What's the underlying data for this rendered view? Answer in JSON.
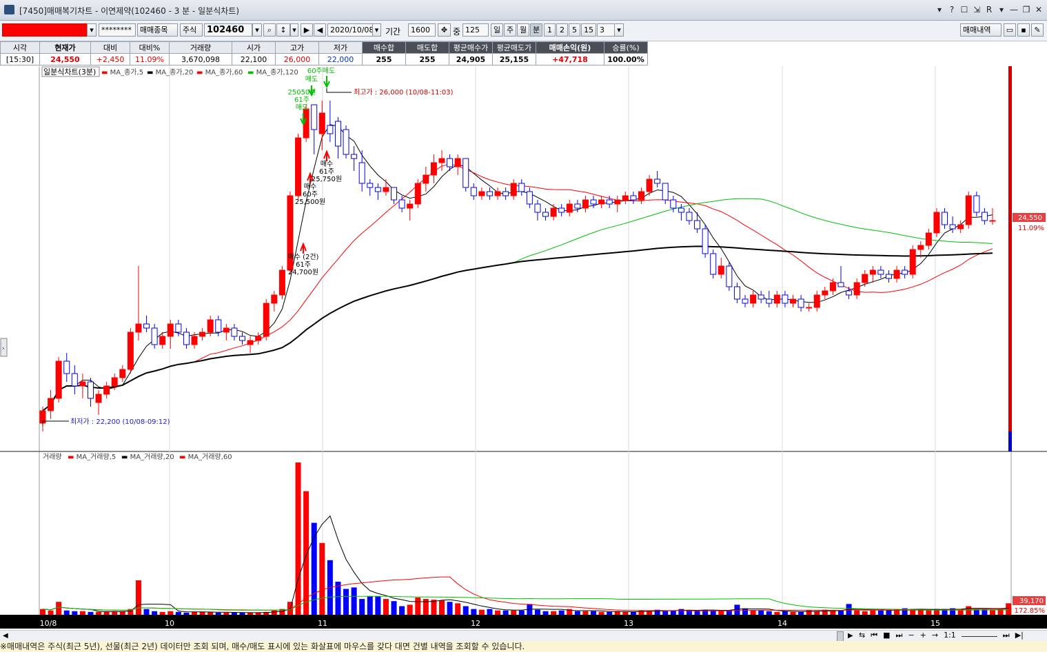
{
  "window": {
    "title": "[7450]매매복기차트 - 이연제약(102460 - 3 분 - 일분식차트)",
    "controls": [
      "▾",
      "?",
      "☐",
      "⇲",
      "R",
      "▾",
      "—",
      "❐",
      "✕"
    ]
  },
  "toolbar": {
    "password": "********",
    "btn_stock": "매매종목",
    "market": "주식",
    "code": "102460",
    "date": "2020/10/08",
    "period_label": "기간",
    "period_value": "1600",
    "count_label": "중",
    "count_value": "125",
    "units": [
      "일",
      "주",
      "월",
      "분",
      "1",
      "2",
      "5",
      "15",
      "3"
    ],
    "btn_trades": "매매내역"
  },
  "quote": {
    "headers": [
      "시각",
      "현재가",
      "대비",
      "대비%",
      "거래량",
      "시가",
      "고가",
      "저가",
      "매수합",
      "매도합",
      "평균매수가",
      "평균매도가",
      "매매손익(원)",
      "승률(%)"
    ],
    "values": [
      "[15:30]",
      "24,550",
      "+2,450",
      "11.09%",
      "3,670,098",
      "22,100",
      "26,000",
      "22,000",
      "255",
      "255",
      "24,905",
      "25,155",
      "+47,718",
      "100.00%"
    ]
  },
  "legend_price": {
    "title": "일분식차트(3분)",
    "items": [
      "MA_종가,5",
      "MA_종가,20",
      "MA_종가,60",
      "MA_종가,120"
    ]
  },
  "legend_volume": {
    "title": "거래량",
    "items": [
      "MA_거래량,5",
      "MA_거래량,20",
      "MA_거래량,60"
    ]
  },
  "annotations": {
    "high": "최고가 : 26,000 (10/08-11:03)",
    "low": "최저가 : 22,200 (10/08-09:12)",
    "buy1": [
      "매수 (2건)",
      "61주",
      "24,700원"
    ],
    "buy2": [
      "매수",
      "60주",
      "25,500원"
    ],
    "buy3": [
      "매수",
      "61주",
      "25,750원"
    ],
    "sell1": [
      "25050원",
      "61주",
      "매도"
    ],
    "sell2": [
      "60주매도",
      "매도"
    ]
  },
  "right_axis": {
    "price": "24,550",
    "pct": "11.09%",
    "vol": "39,170",
    "vol_pct": "172.85%"
  },
  "x_labels": [
    "10/8",
    "10",
    "11",
    "12",
    "13",
    "14",
    "15"
  ],
  "colors": {
    "up": "#ff0000",
    "down": "#0000ff",
    "ma5": "#000000",
    "ma20": "#ff0000",
    "ma60": "#00c000",
    "ma120": "#000000"
  },
  "status": "※매매내역은 주식(최근 5년), 선물(최근 2년) 데이터만 조회 되며, 매수/매도 표시에 있는 화살표에 마우스를 갖다 대면 건별 내역을 조회할 수 있습니다.",
  "zoom": "1:1",
  "chart_data": {
    "type": "candlestick",
    "interval": "3분",
    "series": [
      {
        "o": 22100,
        "h": 22300,
        "l": 22000,
        "c": 22250
      },
      {
        "o": 22250,
        "h": 22500,
        "l": 22150,
        "c": 22400
      },
      {
        "o": 22400,
        "h": 22900,
        "l": 22350,
        "c": 22850
      },
      {
        "o": 22850,
        "h": 22950,
        "l": 22600,
        "c": 22700
      },
      {
        "o": 22700,
        "h": 22800,
        "l": 22450,
        "c": 22550
      },
      {
        "o": 22550,
        "h": 22700,
        "l": 22400,
        "c": 22600
      },
      {
        "o": 22600,
        "h": 22650,
        "l": 22300,
        "c": 22400
      },
      {
        "o": 22350,
        "h": 22500,
        "l": 22200,
        "c": 22450
      },
      {
        "o": 22450,
        "h": 22600,
        "l": 22400,
        "c": 22550
      },
      {
        "o": 22550,
        "h": 22700,
        "l": 22500,
        "c": 22650
      },
      {
        "o": 22650,
        "h": 22800,
        "l": 22600,
        "c": 22750
      },
      {
        "o": 22750,
        "h": 23250,
        "l": 22700,
        "c": 23200
      },
      {
        "o": 23200,
        "h": 24000,
        "l": 23100,
        "c": 23300
      },
      {
        "o": 23300,
        "h": 23400,
        "l": 23200,
        "c": 23250
      },
      {
        "o": 23250,
        "h": 23300,
        "l": 23000,
        "c": 23050
      },
      {
        "o": 23050,
        "h": 23200,
        "l": 23000,
        "c": 23150
      },
      {
        "o": 23150,
        "h": 23350,
        "l": 23000,
        "c": 23300
      },
      {
        "o": 23300,
        "h": 23350,
        "l": 23150,
        "c": 23200
      },
      {
        "o": 23200,
        "h": 23250,
        "l": 23000,
        "c": 23050
      },
      {
        "o": 23050,
        "h": 23200,
        "l": 23000,
        "c": 23150
      },
      {
        "o": 23150,
        "h": 23250,
        "l": 23100,
        "c": 23200
      },
      {
        "o": 23200,
        "h": 23400,
        "l": 23150,
        "c": 23350
      },
      {
        "o": 23350,
        "h": 23400,
        "l": 23150,
        "c": 23200
      },
      {
        "o": 23200,
        "h": 23300,
        "l": 23100,
        "c": 23250
      },
      {
        "o": 23250,
        "h": 23300,
        "l": 23100,
        "c": 23150
      },
      {
        "o": 23150,
        "h": 23200,
        "l": 23050,
        "c": 23100
      },
      {
        "o": 23050,
        "h": 23150,
        "l": 22950,
        "c": 23100
      },
      {
        "o": 23100,
        "h": 23200,
        "l": 23050,
        "c": 23150
      },
      {
        "o": 23150,
        "h": 23600,
        "l": 23100,
        "c": 23550
      },
      {
        "o": 23550,
        "h": 23700,
        "l": 23450,
        "c": 23650
      },
      {
        "o": 23650,
        "h": 24000,
        "l": 23600,
        "c": 23950
      },
      {
        "o": 23950,
        "h": 24900,
        "l": 23900,
        "c": 24850
      },
      {
        "o": 24850,
        "h": 25600,
        "l": 24800,
        "c": 25550
      },
      {
        "o": 25550,
        "h": 25950,
        "l": 25500,
        "c": 25900
      },
      {
        "o": 25950,
        "h": 25950,
        "l": 25350,
        "c": 25650
      },
      {
        "o": 25600,
        "h": 26000,
        "l": 25400,
        "c": 25850
      },
      {
        "o": 25700,
        "h": 26000,
        "l": 25500,
        "c": 25600
      },
      {
        "o": 25750,
        "h": 25800,
        "l": 25300,
        "c": 25450
      },
      {
        "o": 25650,
        "h": 25700,
        "l": 25300,
        "c": 25350
      },
      {
        "o": 25350,
        "h": 25450,
        "l": 25150,
        "c": 25300
      },
      {
        "o": 25250,
        "h": 25400,
        "l": 24900,
        "c": 25000
      },
      {
        "o": 25000,
        "h": 25050,
        "l": 24850,
        "c": 24950
      },
      {
        "o": 24950,
        "h": 25000,
        "l": 24800,
        "c": 24900
      },
      {
        "o": 24900,
        "h": 25050,
        "l": 24850,
        "c": 24950
      },
      {
        "o": 24950,
        "h": 24950,
        "l": 24750,
        "c": 24800
      },
      {
        "o": 24800,
        "h": 24850,
        "l": 24650,
        "c": 24700
      },
      {
        "o": 24700,
        "h": 24800,
        "l": 24550,
        "c": 24750
      },
      {
        "o": 24750,
        "h": 25050,
        "l": 24700,
        "c": 25000
      },
      {
        "o": 25000,
        "h": 25200,
        "l": 24900,
        "c": 25100
      },
      {
        "o": 25100,
        "h": 25350,
        "l": 25000,
        "c": 25250
      },
      {
        "o": 25250,
        "h": 25400,
        "l": 25150,
        "c": 25300
      },
      {
        "o": 25300,
        "h": 25350,
        "l": 25150,
        "c": 25200
      },
      {
        "o": 25200,
        "h": 25350,
        "l": 25100,
        "c": 25300
      },
      {
        "o": 25300,
        "h": 25300,
        "l": 24900,
        "c": 24950
      },
      {
        "o": 24950,
        "h": 25000,
        "l": 24800,
        "c": 24850
      },
      {
        "o": 24850,
        "h": 24950,
        "l": 24800,
        "c": 24900
      },
      {
        "o": 24900,
        "h": 24950,
        "l": 24800,
        "c": 24850
      },
      {
        "o": 24850,
        "h": 24950,
        "l": 24800,
        "c": 24900
      },
      {
        "o": 24900,
        "h": 24950,
        "l": 24800,
        "c": 24850
      },
      {
        "o": 24850,
        "h": 25050,
        "l": 24800,
        "c": 25000
      },
      {
        "o": 25000,
        "h": 25050,
        "l": 24850,
        "c": 24900
      },
      {
        "o": 24900,
        "h": 24950,
        "l": 24700,
        "c": 24750
      },
      {
        "o": 24750,
        "h": 24800,
        "l": 24550,
        "c": 24650
      },
      {
        "o": 24650,
        "h": 24700,
        "l": 24550,
        "c": 24600
      },
      {
        "o": 24600,
        "h": 24750,
        "l": 24550,
        "c": 24700
      },
      {
        "o": 24700,
        "h": 24750,
        "l": 24600,
        "c": 24650
      },
      {
        "o": 24650,
        "h": 24800,
        "l": 24600,
        "c": 24750
      },
      {
        "o": 24750,
        "h": 24800,
        "l": 24650,
        "c": 24700
      },
      {
        "o": 24700,
        "h": 24850,
        "l": 24650,
        "c": 24800
      },
      {
        "o": 24800,
        "h": 24850,
        "l": 24700,
        "c": 24750
      },
      {
        "o": 24750,
        "h": 24850,
        "l": 24700,
        "c": 24800
      },
      {
        "o": 24800,
        "h": 24850,
        "l": 24700,
        "c": 24750
      },
      {
        "o": 24750,
        "h": 24850,
        "l": 24650,
        "c": 24800
      },
      {
        "o": 24800,
        "h": 24900,
        "l": 24750,
        "c": 24850
      },
      {
        "o": 24850,
        "h": 24900,
        "l": 24750,
        "c": 24800
      },
      {
        "o": 24800,
        "h": 24950,
        "l": 24750,
        "c": 24900
      },
      {
        "o": 24900,
        "h": 25100,
        "l": 24850,
        "c": 25050
      },
      {
        "o": 25050,
        "h": 25150,
        "l": 24950,
        "c": 25000
      },
      {
        "o": 25000,
        "h": 25000,
        "l": 24750,
        "c": 24800
      },
      {
        "o": 24800,
        "h": 24850,
        "l": 24650,
        "c": 24700
      },
      {
        "o": 24700,
        "h": 24750,
        "l": 24550,
        "c": 24650
      },
      {
        "o": 24650,
        "h": 24700,
        "l": 24500,
        "c": 24550
      },
      {
        "o": 24550,
        "h": 24650,
        "l": 24400,
        "c": 24450
      },
      {
        "o": 24450,
        "h": 24500,
        "l": 24100,
        "c": 24150
      },
      {
        "o": 24150,
        "h": 24200,
        "l": 23850,
        "c": 23900
      },
      {
        "o": 23900,
        "h": 24100,
        "l": 23850,
        "c": 24000
      },
      {
        "o": 24000,
        "h": 24050,
        "l": 23700,
        "c": 23750
      },
      {
        "o": 23750,
        "h": 23800,
        "l": 23550,
        "c": 23600
      },
      {
        "o": 23600,
        "h": 23650,
        "l": 23500,
        "c": 23550
      },
      {
        "o": 23550,
        "h": 23700,
        "l": 23500,
        "c": 23650
      },
      {
        "o": 23650,
        "h": 23700,
        "l": 23550,
        "c": 23600
      },
      {
        "o": 23600,
        "h": 23700,
        "l": 23500,
        "c": 23550
      },
      {
        "o": 23550,
        "h": 23700,
        "l": 23500,
        "c": 23650
      },
      {
        "o": 23650,
        "h": 23700,
        "l": 23500,
        "c": 23550
      },
      {
        "o": 23550,
        "h": 23650,
        "l": 23500,
        "c": 23600
      },
      {
        "o": 23600,
        "h": 23650,
        "l": 23450,
        "c": 23500
      },
      {
        "o": 23500,
        "h": 23550,
        "l": 23450,
        "c": 23500
      },
      {
        "o": 23500,
        "h": 23700,
        "l": 23450,
        "c": 23650
      },
      {
        "o": 23650,
        "h": 23750,
        "l": 23600,
        "c": 23700
      },
      {
        "o": 23700,
        "h": 23850,
        "l": 23650,
        "c": 23800
      },
      {
        "o": 23800,
        "h": 24000,
        "l": 23750,
        "c": 23750
      },
      {
        "o": 23700,
        "h": 23750,
        "l": 23600,
        "c": 23650
      },
      {
        "o": 23650,
        "h": 23850,
        "l": 23600,
        "c": 23800
      },
      {
        "o": 23800,
        "h": 23950,
        "l": 23750,
        "c": 23900
      },
      {
        "o": 23900,
        "h": 24000,
        "l": 23800,
        "c": 23950
      },
      {
        "o": 23950,
        "h": 24000,
        "l": 23850,
        "c": 23900
      },
      {
        "o": 23900,
        "h": 23950,
        "l": 23800,
        "c": 23850
      },
      {
        "o": 23850,
        "h": 24000,
        "l": 23800,
        "c": 23950
      },
      {
        "o": 23950,
        "h": 24000,
        "l": 23850,
        "c": 23900
      },
      {
        "o": 23900,
        "h": 24250,
        "l": 23850,
        "c": 24200
      },
      {
        "o": 24200,
        "h": 24300,
        "l": 24100,
        "c": 24250
      },
      {
        "o": 24250,
        "h": 24450,
        "l": 24200,
        "c": 24400
      },
      {
        "o": 24400,
        "h": 24700,
        "l": 24350,
        "c": 24650
      },
      {
        "o": 24650,
        "h": 24700,
        "l": 24450,
        "c": 24500
      },
      {
        "o": 24500,
        "h": 24600,
        "l": 24400,
        "c": 24450
      },
      {
        "o": 24450,
        "h": 24550,
        "l": 24400,
        "c": 24500
      },
      {
        "o": 24500,
        "h": 24900,
        "l": 24450,
        "c": 24850
      },
      {
        "o": 24850,
        "h": 24900,
        "l": 24600,
        "c": 24650
      },
      {
        "o": 24650,
        "h": 24700,
        "l": 24500,
        "c": 24550
      },
      {
        "o": 24550,
        "h": 24700,
        "l": 24500,
        "c": 24550
      }
    ],
    "volume": [
      40000,
      30000,
      90000,
      30000,
      25000,
      25000,
      20000,
      20000,
      20000,
      25000,
      25000,
      40000,
      240000,
      40000,
      25000,
      20000,
      25000,
      20000,
      15000,
      20000,
      20000,
      20000,
      15000,
      15000,
      15000,
      15000,
      15000,
      15000,
      20000,
      30000,
      40000,
      90000,
      1060000,
      860000,
      640000,
      500000,
      380000,
      230000,
      180000,
      190000,
      110000,
      130000,
      130000,
      110000,
      95000,
      60000,
      70000,
      120000,
      110000,
      105000,
      100000,
      90000,
      80000,
      60000,
      40000,
      35000,
      40000,
      30000,
      30000,
      30000,
      30000,
      75000,
      35000,
      25000,
      25000,
      30000,
      40000,
      25000,
      25000,
      25000,
      20000,
      20000,
      25000,
      20000,
      20000,
      30000,
      25000,
      35000,
      25000,
      30000,
      40000,
      30000,
      30000,
      35000,
      30000,
      30000,
      30000,
      70000,
      45000,
      30000,
      30000,
      25000,
      20000,
      25000,
      20000,
      20000,
      30000,
      25000,
      35000,
      30000,
      30000,
      75000,
      30000,
      25000,
      30000,
      30000,
      35000,
      40000,
      45000,
      40000,
      35000,
      30000,
      40000,
      40000,
      45000,
      40000,
      60000,
      40000,
      40000,
      35000,
      40000,
      80000
    ],
    "y_range": [
      22000,
      26250
    ],
    "ma_periods": [
      5,
      20,
      60,
      120
    ],
    "volume_ma_periods": [
      5,
      20,
      60
    ]
  }
}
